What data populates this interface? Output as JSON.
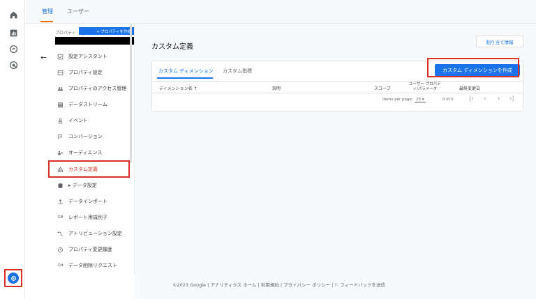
{
  "topbar": {
    "tabs": [
      {
        "label": "管理",
        "active": true
      },
      {
        "label": "ユーザー",
        "active": false
      }
    ]
  },
  "rail": {
    "icons": [
      "home-icon",
      "reports-icon",
      "explore-icon",
      "advertising-icon"
    ],
    "settings_icon": "gear-icon"
  },
  "sidebar": {
    "property_label": "プロパティ",
    "create_property_label": "+ プロパティを作成",
    "items": [
      {
        "label": "設定アシスタント",
        "icon": "checklist-icon"
      },
      {
        "label": "プロパティ設定",
        "icon": "property-icon"
      },
      {
        "label": "プロパティのアクセス管理",
        "icon": "people-icon"
      },
      {
        "label": "データストリーム",
        "icon": "stream-icon"
      },
      {
        "label": "イベント",
        "icon": "event-icon"
      },
      {
        "label": "コンバージョン",
        "icon": "flag-icon"
      },
      {
        "label": "オーディエンス",
        "icon": "audience-icon"
      },
      {
        "label": "カスタム定義",
        "icon": "custom-definitions-icon",
        "active": true
      },
      {
        "label": "▸ データ設定",
        "icon": "database-icon"
      },
      {
        "label": "データインポート",
        "icon": "upload-icon"
      },
      {
        "label": "レポート用識別子",
        "icon": "identity-icon"
      },
      {
        "label": "アトリビューション設定",
        "icon": "attribution-icon"
      },
      {
        "label": "プロパティ変更履歴",
        "icon": "history-icon"
      },
      {
        "label": "データ削除リクエスト",
        "icon": "data-delete-icon"
      }
    ],
    "identity_prefix": "GB",
    "delete_prefix": "Dd"
  },
  "main": {
    "title": "カスタム定義",
    "assign_button": "割り当て情報",
    "tabs": [
      {
        "label": "カスタム ディメンション",
        "active": true
      },
      {
        "label": "カスタム指標",
        "active": false
      }
    ],
    "create_button": "カスタム ディメンションを作成",
    "columns": {
      "name": "ディメンション名 ↑",
      "description": "説明",
      "scope": "スコープ",
      "user_property_line1": "ユーザー プロパテ",
      "user_property_line2": "ィ/パラメータ",
      "last_changed": "最終変更日"
    },
    "pager": {
      "items_per_page_label": "Items per page:",
      "page_size": "25",
      "range": "0 of 0"
    }
  },
  "footer": {
    "text": "©2023 Google | アナリティクス ホーム | 利用規約 | プライバシー ポリシー | ⚐ フィードバックを送信"
  },
  "colors": {
    "accent": "#1a73e8",
    "highlight": "#d93025",
    "tab_underline": "#e8710a"
  }
}
